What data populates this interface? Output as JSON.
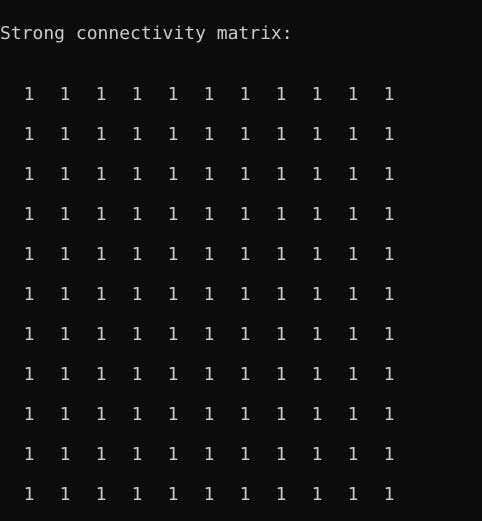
{
  "console": {
    "background": "#0c0c0c",
    "foreground": "#cccccc",
    "heading": "Strong connectivity matrix:"
  },
  "matrix": {
    "rows": [
      [
        "1",
        "1",
        "1",
        "1",
        "1",
        "1",
        "1",
        "1",
        "1",
        "1",
        "1"
      ],
      [
        "1",
        "1",
        "1",
        "1",
        "1",
        "1",
        "1",
        "1",
        "1",
        "1",
        "1"
      ],
      [
        "1",
        "1",
        "1",
        "1",
        "1",
        "1",
        "1",
        "1",
        "1",
        "1",
        "1"
      ],
      [
        "1",
        "1",
        "1",
        "1",
        "1",
        "1",
        "1",
        "1",
        "1",
        "1",
        "1"
      ],
      [
        "1",
        "1",
        "1",
        "1",
        "1",
        "1",
        "1",
        "1",
        "1",
        "1",
        "1"
      ],
      [
        "1",
        "1",
        "1",
        "1",
        "1",
        "1",
        "1",
        "1",
        "1",
        "1",
        "1"
      ],
      [
        "1",
        "1",
        "1",
        "1",
        "1",
        "1",
        "1",
        "1",
        "1",
        "1",
        "1"
      ],
      [
        "1",
        "1",
        "1",
        "1",
        "1",
        "1",
        "1",
        "1",
        "1",
        "1",
        "1"
      ],
      [
        "1",
        "1",
        "1",
        "1",
        "1",
        "1",
        "1",
        "1",
        "1",
        "1",
        "1"
      ],
      [
        "1",
        "1",
        "1",
        "1",
        "1",
        "1",
        "1",
        "1",
        "1",
        "1",
        "1"
      ],
      [
        "1",
        "1",
        "1",
        "1",
        "1",
        "1",
        "1",
        "1",
        "1",
        "1",
        "1"
      ]
    ]
  }
}
